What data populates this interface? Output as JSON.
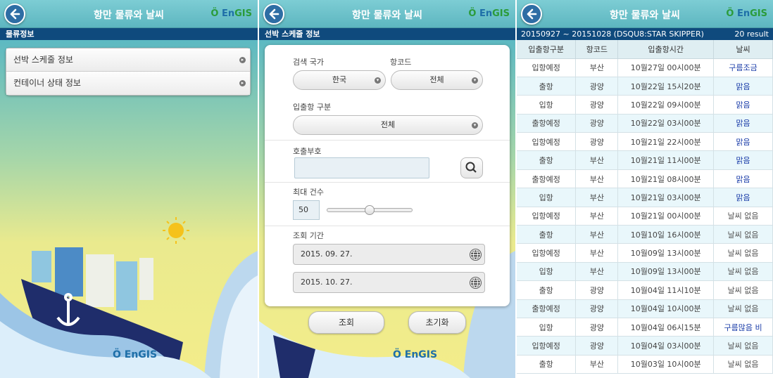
{
  "app_title": "항만 물류와 날씨",
  "logo": {
    "prefix": "En",
    "suffix": "GIS"
  },
  "colors": {
    "header_bg": "#5db6c0",
    "subbar_bg": "#0f4a7d",
    "weather_link": "#1a3ca8"
  },
  "screen1": {
    "subtitle": "물류정보",
    "menu": [
      {
        "label": "선박 스케줄 정보"
      },
      {
        "label": "컨테이너 상태 정보"
      }
    ],
    "brand": "EnGIS"
  },
  "screen2": {
    "subtitle": "선박 스케줄 정보",
    "country_label": "검색 국가",
    "country_value": "한국",
    "port_label": "항코드",
    "port_value": "전체",
    "io_label": "입출항 구분",
    "io_value": "전체",
    "call_label": "호출부호",
    "call_value": "",
    "max_label": "최대 건수",
    "max_value": "50",
    "max_slider_fraction": 0.5,
    "period_label": "조회 기간",
    "date_from": "2015. 09. 27.",
    "date_to": "2015. 10. 27.",
    "search_button": "조회",
    "reset_button": "초기화",
    "brand": "EnGIS"
  },
  "screen3": {
    "range": "20150927 ~ 20151028 (DSQU8:STAR SKIPPER)",
    "count": "20 result",
    "columns": [
      "입출항구분",
      "항코드",
      "입출항시간",
      "날씨"
    ],
    "rows": [
      [
        "입항예정",
        "부산",
        "10월27일 00시00분",
        "구름조금"
      ],
      [
        "출항",
        "광양",
        "10월22일 15시20분",
        "맑음"
      ],
      [
        "입항",
        "광양",
        "10월22일 09시00분",
        "맑음"
      ],
      [
        "출항예정",
        "광양",
        "10월22일 03시00분",
        "맑음"
      ],
      [
        "입항예정",
        "광양",
        "10월21일 22시00분",
        "맑음"
      ],
      [
        "출항",
        "부산",
        "10월21일 11시00분",
        "맑음"
      ],
      [
        "출항예정",
        "부산",
        "10월21일 08시00분",
        "맑음"
      ],
      [
        "입항",
        "부산",
        "10월21일 03시00분",
        "맑음"
      ],
      [
        "입항예정",
        "부산",
        "10월21일 00시00분",
        "날씨 없음"
      ],
      [
        "출항",
        "부산",
        "10월10일 16시00분",
        "날씨 없음"
      ],
      [
        "입항예정",
        "부산",
        "10월09일 13시00분",
        "날씨 없음"
      ],
      [
        "입항",
        "부산",
        "10월09일 13시00분",
        "날씨 없음"
      ],
      [
        "출항",
        "광양",
        "10월04일 11시10분",
        "날씨 없음"
      ],
      [
        "출항예정",
        "광양",
        "10월04일 10시00분",
        "날씨 없음"
      ],
      [
        "입항",
        "광양",
        "10월04일 06시15분",
        "구름많음 비"
      ],
      [
        "입항예정",
        "광양",
        "10월04일 03시00분",
        "날씨 없음"
      ],
      [
        "출항",
        "부산",
        "10월03일 10시00분",
        "날씨 없음"
      ]
    ]
  }
}
